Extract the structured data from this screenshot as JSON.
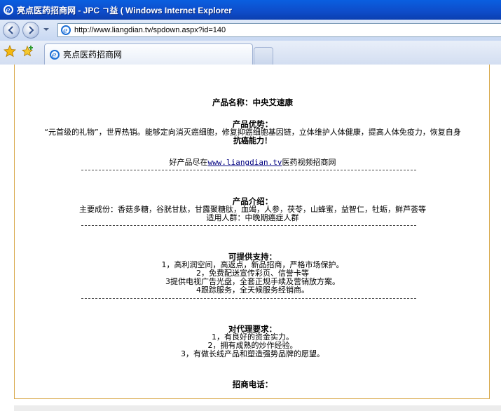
{
  "window": {
    "title": "亮点医药招商网 - JPC ㄱ益 ( Windows Internet Explorer"
  },
  "addressbar": {
    "url": "http://www.liangdian.tv/spdown.aspx?id=140"
  },
  "tab": {
    "label": "亮点医药招商网"
  },
  "product": {
    "name_line": "产品名称：中央艾速康",
    "advantage_heading": "产品优势：",
    "advantage_text_1": "“元首级的礼物”，世界热销。能够定向消灭癌细胞，修复抑癌细胞基因链，立体维护人体健康，提高人体免疫力，恢复自身",
    "advantage_text_2": "抗癌能力！",
    "promo_prefix": "好产品尽在",
    "promo_link": "www.liangdian.tv",
    "promo_suffix": "医药视频招商网",
    "intro_heading": "产品介绍：",
    "ingredients": "主要成份：香菇多糖，谷胱甘肽，甘露聚糖肽，血竭，人参，茯苓，山蜂蜜，益智仁，牡蛎，鲜芦荟等",
    "audience": "适用人群：中晚期癌症人群",
    "support_heading": "可提供支持：",
    "support_items": [
      "1，高利润空间，高返点，新品招商，严格市场保护。",
      "2，免费配送宣传彩页、信誉卡等",
      "3提供电视广告光盘，全套正规手续及营销放方案。",
      "4跟踪服务，全天候服务经销商。"
    ],
    "agent_heading": "对代理要求：",
    "agent_items": [
      "1，有良好的资金实力。",
      "2，拥有成熟的炒作经验。",
      "3，有做长线产品和塑造强势品牌的愿望。"
    ],
    "contact_heading": "招商电话："
  },
  "colors": {
    "titlebar": "#0e4cc9",
    "frame_border": "#d8a84a",
    "link": "#000080"
  },
  "icons": {
    "window_icon": "ie-icon",
    "back": "back-arrow-icon",
    "forward": "forward-arrow-icon",
    "favorites": "star-icon",
    "add_favorites": "add-favorites-icon"
  }
}
